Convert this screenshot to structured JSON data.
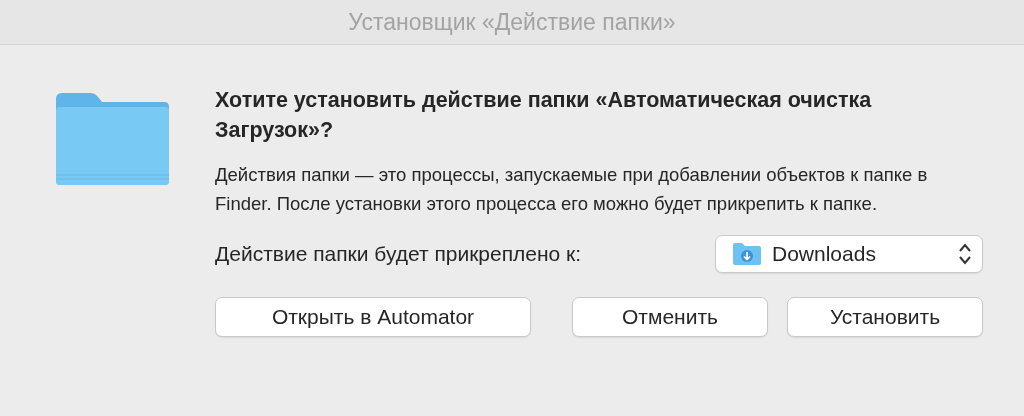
{
  "window": {
    "title": "Установщик «Действие папки»"
  },
  "heading": "Хотите установить действие папки «Автоматическая очистка Загрузок»?",
  "message": "Действия папки — это процессы, запускаемые при добавлении объектов к папке в Finder. После установки этого процесса его можно будет прикрепить к папке.",
  "attach": {
    "label": "Действие папки будет прикреплено к:",
    "value": "Downloads"
  },
  "buttons": [
    {
      "label": "Открыть в Automator"
    },
    {
      "label": "Отменить"
    },
    {
      "label": "Установить"
    }
  ]
}
